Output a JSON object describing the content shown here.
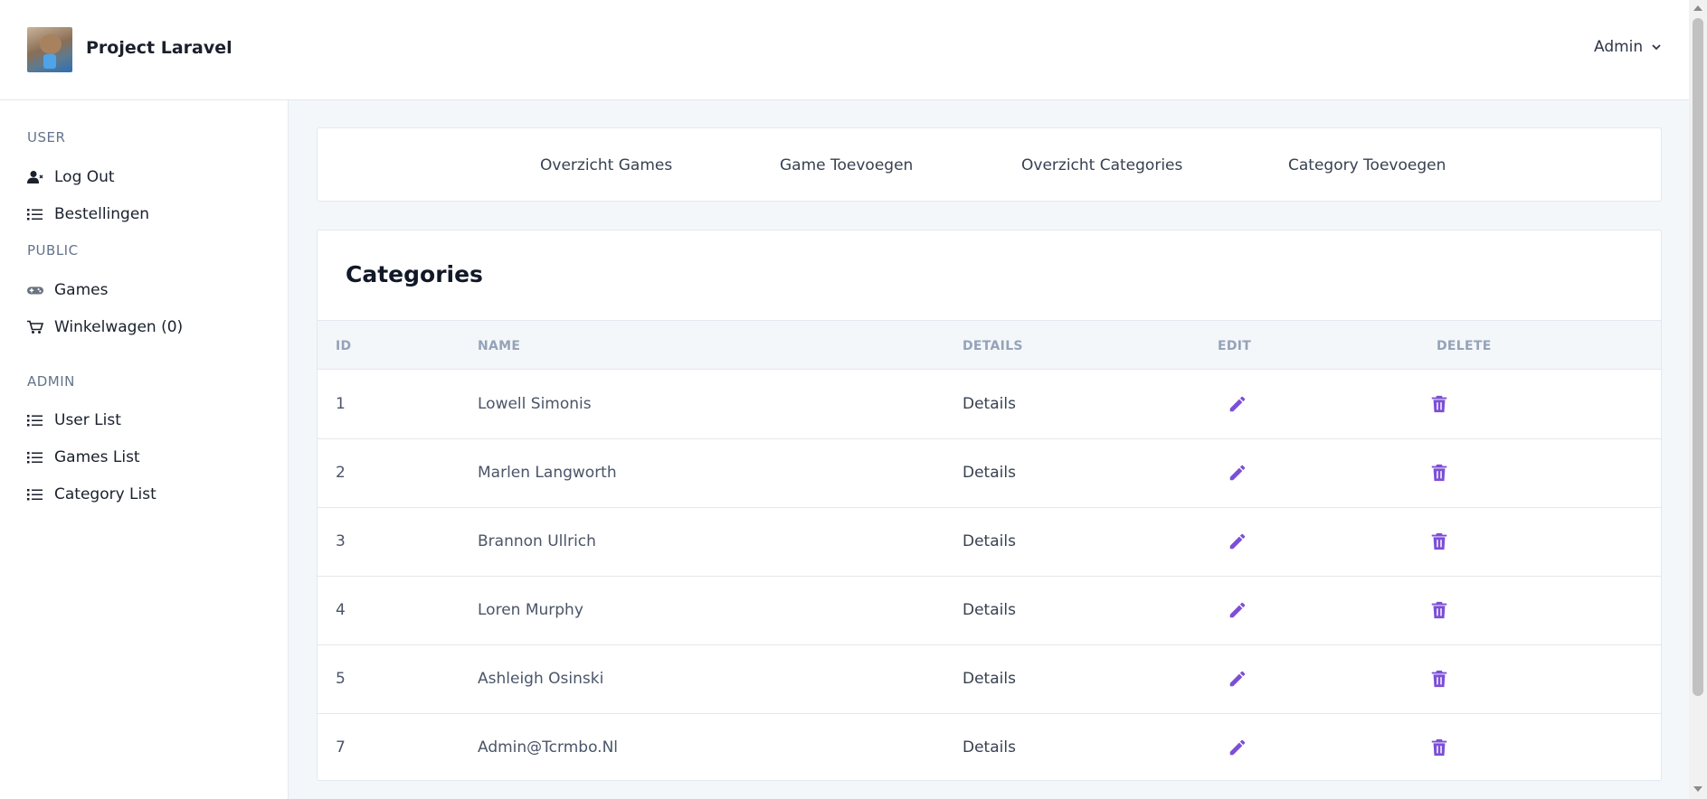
{
  "app": {
    "title": "Project Laravel",
    "user_menu_label": "Admin"
  },
  "sidebar": {
    "sections": {
      "user": "USER",
      "public": "PUBLIC",
      "admin": "ADMIN"
    },
    "items": {
      "logout": "Log Out",
      "orders": "Bestellingen",
      "games": "Games",
      "cart": "Winkelwagen (0)",
      "user_list": "User List",
      "games_list": "Games List",
      "category_list": "Category List"
    }
  },
  "topnav": {
    "overview_games": "Overzicht Games",
    "add_game": "Game Toevoegen",
    "overview_categories": "Overzicht Categories",
    "add_category": "Category Toevoegen"
  },
  "page": {
    "title": "Categories"
  },
  "table": {
    "headers": {
      "id": "ID",
      "name": "NAME",
      "details": "DETAILS",
      "edit": "EDIT",
      "delete": "DELETE"
    },
    "rows": [
      {
        "id": "1",
        "name": "Lowell Simonis",
        "details": "Details"
      },
      {
        "id": "2",
        "name": "Marlen Langworth",
        "details": "Details"
      },
      {
        "id": "3",
        "name": "Brannon Ullrich",
        "details": "Details"
      },
      {
        "id": "4",
        "name": "Loren Murphy",
        "details": "Details"
      },
      {
        "id": "5",
        "name": "Ashleigh Osinski",
        "details": "Details"
      },
      {
        "id": "7",
        "name": "Admin@Tcrmbo.Nl",
        "details": "Details"
      }
    ]
  },
  "colors": {
    "accent": "#7c4fd6",
    "muted": "#94a3b8",
    "page_bg": "#f4f7fa"
  },
  "icons": {
    "logout": "user-logout-icon",
    "list": "list-icon",
    "games": "gamepad-icon",
    "cart": "cart-icon",
    "edit": "pencil-icon",
    "delete": "trash-icon",
    "dropdown": "chevron-down-icon"
  }
}
